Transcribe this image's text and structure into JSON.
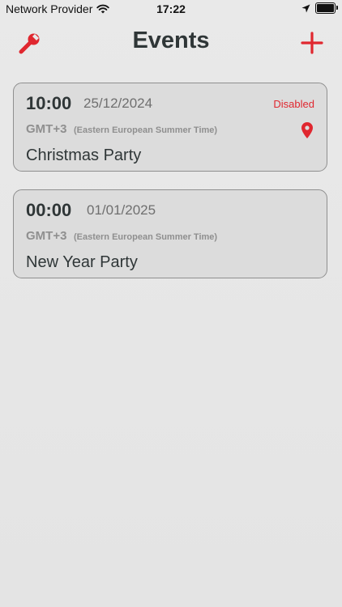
{
  "status_bar": {
    "carrier": "Network Provider",
    "time": "17:22"
  },
  "header": {
    "title": "Events",
    "left_icon": "wrench-icon",
    "right_icon": "plus-icon"
  },
  "events": [
    {
      "time": "10:00",
      "date": "25/12/2024",
      "gmt": "GMT+3",
      "timezone_name": "(Eastern European Summer Time)",
      "title": "Christmas Party",
      "status": "Disabled",
      "has_location": true
    },
    {
      "time": "00:00",
      "date": "01/01/2025",
      "gmt": "GMT+3",
      "timezone_name": "(Eastern European Summer Time)",
      "title": "New Year Party"
    }
  ],
  "colors": {
    "accent": "#e0272f",
    "text_primary": "#2f3637",
    "text_secondary": "#8f8f8f",
    "card_bg": "#dcdcdc"
  }
}
